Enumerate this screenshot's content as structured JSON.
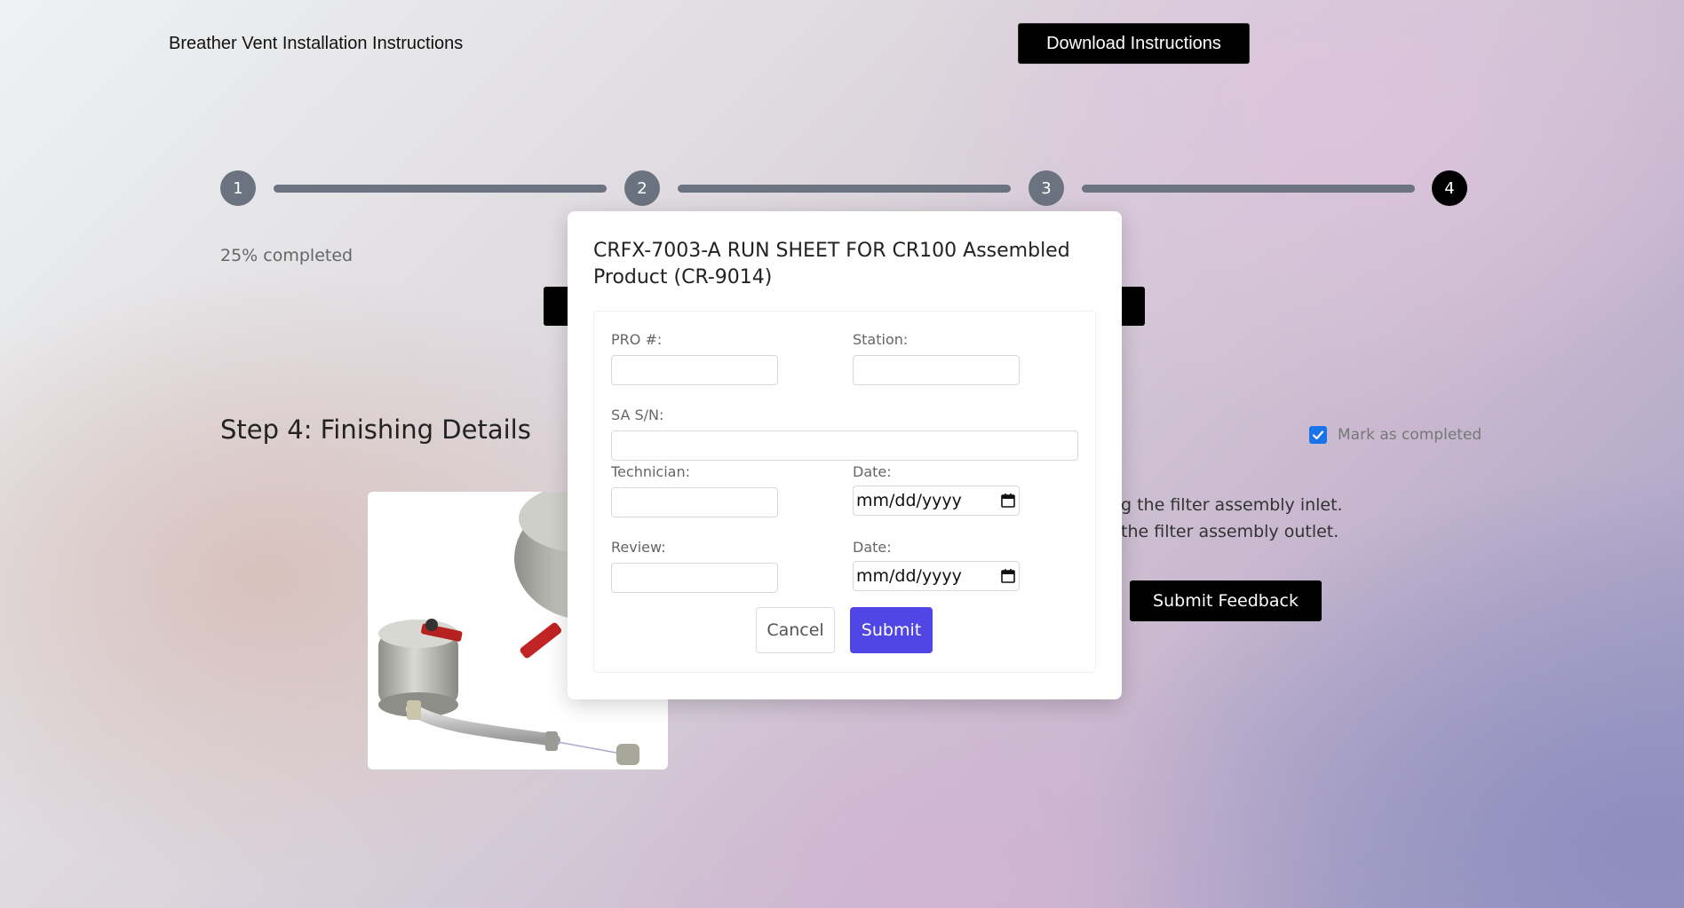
{
  "header": {
    "title": "Breather Vent Installation Instructions",
    "download_label": "Download Instructions"
  },
  "stepper": {
    "steps": [
      "1",
      "2",
      "3",
      "4"
    ],
    "current_step": 4,
    "progress_text": "25% completed"
  },
  "step": {
    "heading": "Step 4: Finishing Details",
    "mark_completed_label": "Mark as completed",
    "mark_completed_checked": true,
    "instruction_line1": "g the filter assembly inlet.",
    "instruction_line2": "the filter assembly outlet.",
    "feedback_label": "Submit Feedback"
  },
  "modal": {
    "title": "CRFX-7003-A RUN SHEET FOR CR100 Assembled Product (CR-9014)",
    "fields": {
      "pro_label": "PRO #:",
      "pro_value": "",
      "station_label": "Station:",
      "station_value": "",
      "sasn_label": "SA S/N:",
      "sasn_value": "",
      "technician_label": "Technician:",
      "technician_value": "",
      "date1_label": "Date:",
      "date1_value": "mm/dd/yyyy",
      "review_label": "Review:",
      "review_value": "",
      "date2_label": "Date:",
      "date2_value": "mm/dd/yyyy"
    },
    "cancel_label": "Cancel",
    "submit_label": "Submit"
  },
  "colors": {
    "accent": "#4f46e5",
    "step_inactive": "#6b7280",
    "step_active": "#000000",
    "checkbox": "#1a73e8"
  },
  "icons": {
    "calendar": "calendar-icon",
    "check": "checkmark-icon"
  }
}
